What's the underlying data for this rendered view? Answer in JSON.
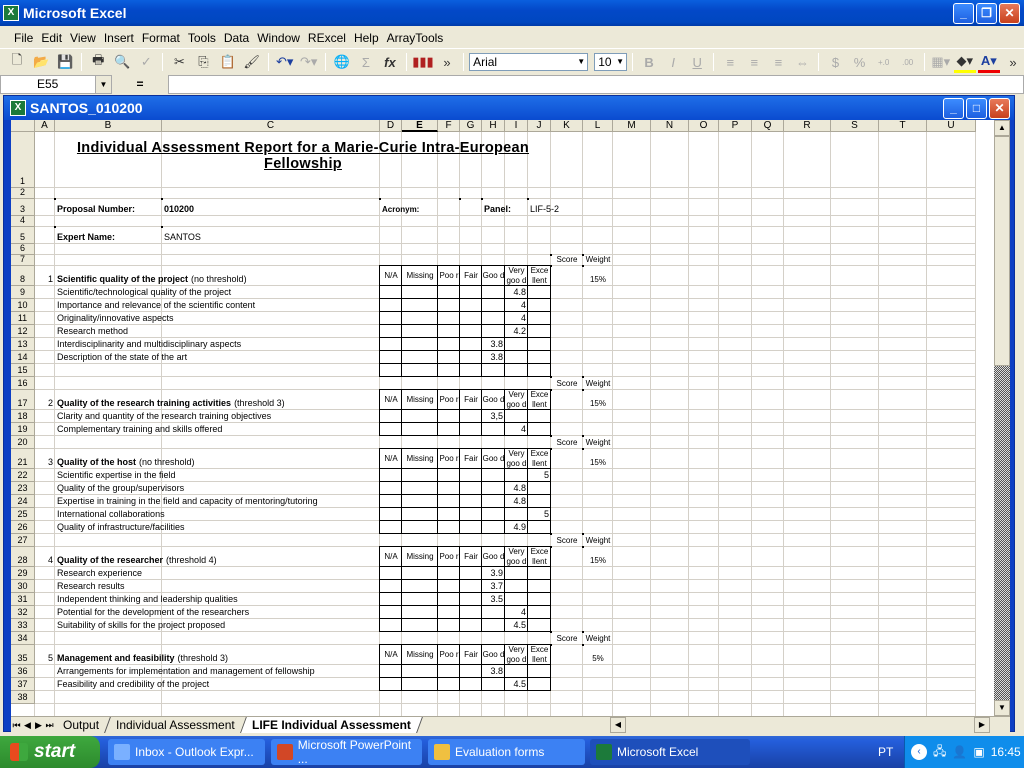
{
  "app": {
    "title": "Microsoft Excel"
  },
  "menu": [
    "File",
    "Edit",
    "View",
    "Insert",
    "Format",
    "Tools",
    "Data",
    "Window",
    "RExcel",
    "Help",
    "ArrayTools"
  ],
  "toolbar": {
    "font": "Arial",
    "size": "10"
  },
  "formula_bar": {
    "name_box": "E55",
    "equals": "=",
    "value": ""
  },
  "workbook": {
    "title": "SANTOS_010200"
  },
  "columns": [
    "A",
    "B",
    "C",
    "D",
    "E",
    "F",
    "G",
    "H",
    "I",
    "J",
    "K",
    "L",
    "M",
    "N",
    "O",
    "P",
    "Q",
    "R",
    "S",
    "T",
    "U"
  ],
  "selected_column": "E",
  "report": {
    "title_line1": "Individual Assessment Report for a Marie-Curie Intra-European",
    "title_line2": "Fellowship",
    "proposal_label": "Proposal Number:",
    "proposal_value": "010200",
    "acronym_label": "Acronym:",
    "acronym_value": "",
    "panel_label": "Panel:",
    "panel_value": "LIF-5-2",
    "expert_label": "Expert Name:",
    "expert_value": "SANTOS",
    "score_label": "Score",
    "weight_label": "Weight",
    "rating_headers": [
      "N/A",
      "Missing",
      "Poo r",
      "Fair",
      "Goo d",
      "Very goo d",
      "Exce llent"
    ]
  },
  "sections": [
    {
      "num": "1",
      "title": "Scientific quality of the project",
      "threshold": "(no threshold)",
      "weight": "15%",
      "items": [
        {
          "label": "Scientific/technological quality of the project",
          "rating": "Very good",
          "score": "4.8"
        },
        {
          "label": "Importance and relevance of the scientific content",
          "rating": "Very good",
          "score": "4"
        },
        {
          "label": "Originality/innovative aspects",
          "rating": "Very good",
          "score": "4"
        },
        {
          "label": "Research method",
          "rating": "Very good",
          "score": "4.2"
        },
        {
          "label": "Interdisciplinarity and multidisciplinary aspects",
          "rating": "Good",
          "score": "3.8"
        },
        {
          "label": "Description of the state of the art",
          "rating": "Good",
          "score": "3.8"
        }
      ]
    },
    {
      "num": "2",
      "title": "Quality of the research training activities",
      "threshold": "(threshold 3)",
      "weight": "15%",
      "items": [
        {
          "label": "Clarity and quantity of the research training objectives",
          "rating": "Good",
          "score": "3,5"
        },
        {
          "label": "Complementary training and skills offered",
          "rating": "Very good",
          "score": "4"
        }
      ]
    },
    {
      "num": "3",
      "title": "Quality of the host",
      "threshold": "(no threshold)",
      "weight": "15%",
      "items": [
        {
          "label": "Scientific expertise in the field",
          "rating": "Excellent",
          "score": "5"
        },
        {
          "label": "Quality of the group/supervisors",
          "rating": "Very good",
          "score": "4.8"
        },
        {
          "label": "Expertise in training in the field and capacity of mentoring/tutoring",
          "rating": "Very good",
          "score": "4.8"
        },
        {
          "label": "International collaborations",
          "rating": "Excellent",
          "score": "5"
        },
        {
          "label": "Quality of infrastructure/facilities",
          "rating": "Very good",
          "score": "4.9"
        }
      ]
    },
    {
      "num": "4",
      "title": "Quality of the researcher",
      "threshold": "(threshold 4)",
      "weight": "15%",
      "items": [
        {
          "label": "Research experience",
          "rating": "Good",
          "score": "3.9"
        },
        {
          "label": "Research results",
          "rating": "Good",
          "score": "3.7"
        },
        {
          "label": "Independent thinking and leadership qualities",
          "rating": "Good",
          "score": "3.5"
        },
        {
          "label": "Potential for the development of the researchers",
          "rating": "Very good",
          "score": "4"
        },
        {
          "label": "Suitability of skills for the project proposed",
          "rating": "Very good",
          "score": "4.5"
        }
      ]
    },
    {
      "num": "5",
      "title": "Management and feasibility",
      "threshold": "(threshold 3)",
      "weight": "5%",
      "items": [
        {
          "label": "Arrangements for implementation and management of fellowship",
          "rating": "Good",
          "score": "3.8"
        },
        {
          "label": "Feasibility and credibility of the project",
          "rating": "Very good",
          "score": "4.5"
        }
      ]
    }
  ],
  "sheet_tabs": [
    {
      "label": "Output",
      "active": false
    },
    {
      "label": "Individual Assessment",
      "active": false
    },
    {
      "label": "LIFE Individual Assessment",
      "active": true
    }
  ],
  "taskbar": {
    "start": "start",
    "tasks": [
      {
        "label": "Inbox - Outlook Expr...",
        "active": false
      },
      {
        "label": "Microsoft PowerPoint ...",
        "active": false
      },
      {
        "label": "Evaluation forms",
        "active": false
      },
      {
        "label": "Microsoft Excel",
        "active": true
      }
    ],
    "language": "PT",
    "clock": "16:45"
  }
}
